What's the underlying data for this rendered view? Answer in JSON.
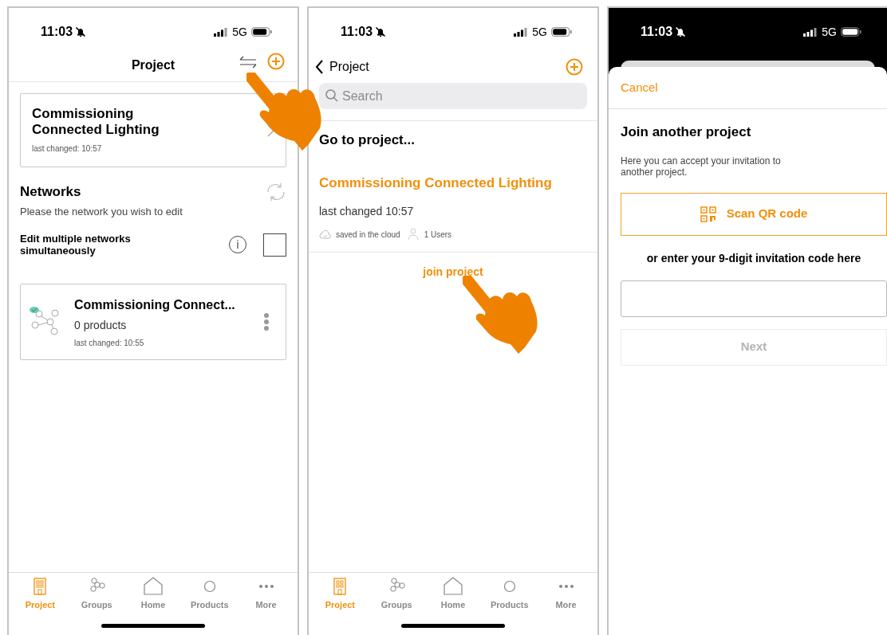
{
  "project_screen": {
    "status_bar": {
      "time": "11:03",
      "network": "5G"
    },
    "header": {
      "title": "Project"
    },
    "current_project": {
      "name": "Commissioning Connected Lighting",
      "last_changed": "last changed: 10:57"
    },
    "networks": {
      "title": "Networks",
      "subtitle": "Please the network you wish to edit",
      "multi_edit_label": "Edit multiple networks simultaneously",
      "multi_edit_checked": false
    },
    "network_cards": [
      {
        "name": "Commissioning Connect...",
        "products": "0 products",
        "last_changed": "last changed: 10:55"
      }
    ],
    "tabs": [
      {
        "label": "Project",
        "selected": true
      },
      {
        "label": "Groups",
        "selected": false
      },
      {
        "label": "Home",
        "selected": false
      },
      {
        "label": "Products",
        "selected": false
      },
      {
        "label": "More",
        "selected": false
      }
    ]
  },
  "project_list_screen": {
    "status_bar": {
      "time": "11:03",
      "network": "5G"
    },
    "header": {
      "back_label": "Project"
    },
    "search": {
      "placeholder": "Search"
    },
    "section_title": "Go to project...",
    "projects": [
      {
        "name": "Commissioning Connected Lighting",
        "last_changed": "last changed 10:57",
        "storage": "saved in the cloud",
        "users": "1 Users"
      }
    ],
    "join_link": "join project",
    "tabs": [
      {
        "label": "Project",
        "selected": true
      },
      {
        "label": "Groups",
        "selected": false
      },
      {
        "label": "Home",
        "selected": false
      },
      {
        "label": "Products",
        "selected": false
      },
      {
        "label": "More",
        "selected": false
      }
    ]
  },
  "join_screen": {
    "status_bar": {
      "time": "11:03",
      "network": "5G"
    },
    "cancel": "Cancel",
    "title": "Join another project",
    "description": "Here you can accept your invitation to another project.",
    "scan_button": "Scan QR code",
    "code_prompt": "or enter your 9-digit invitation code here",
    "next_button": "Next",
    "next_disabled": true
  }
}
